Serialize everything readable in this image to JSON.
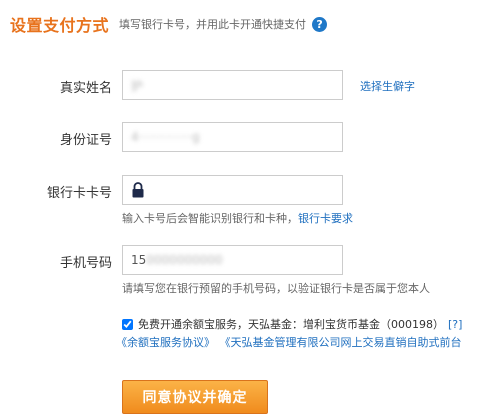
{
  "header": {
    "title": "设置支付方式",
    "subtitle": "填写银行卡号，并用此卡开通快捷支付",
    "help_icon": "?"
  },
  "form": {
    "name": {
      "label": "真实姓名",
      "value": "护",
      "link": "选择生僻字"
    },
    "id_number": {
      "label": "身份证号",
      "value": "4··············g"
    },
    "card_number": {
      "label": "银行卡卡号",
      "icon": "lock-icon",
      "hint_text": "输入卡号后会智能识别银行和卡种，",
      "hint_link": "银行卡要求"
    },
    "phone": {
      "label": "手机号码",
      "value_prefix": "15",
      "value_rest": "0000000000",
      "hint": "请填写您在银行预留的手机号码，以验证银行卡是否属于您本人"
    }
  },
  "agreement": {
    "checked": true,
    "text": "免费开通余额宝服务，天弘基金：增利宝货币基金（000198）",
    "help_link": "[?]",
    "link1": "《余额宝服务协议》",
    "link2": "《天弘基金管理有限公司网上交易直销自助式前台"
  },
  "submit": {
    "label": "同意协议并确定"
  },
  "colors": {
    "accent": "#e8731d",
    "link": "#1f6fbf",
    "help_icon_bg": "#1f78c8",
    "button_top": "#fbb347",
    "button_bottom": "#f08b1d"
  }
}
